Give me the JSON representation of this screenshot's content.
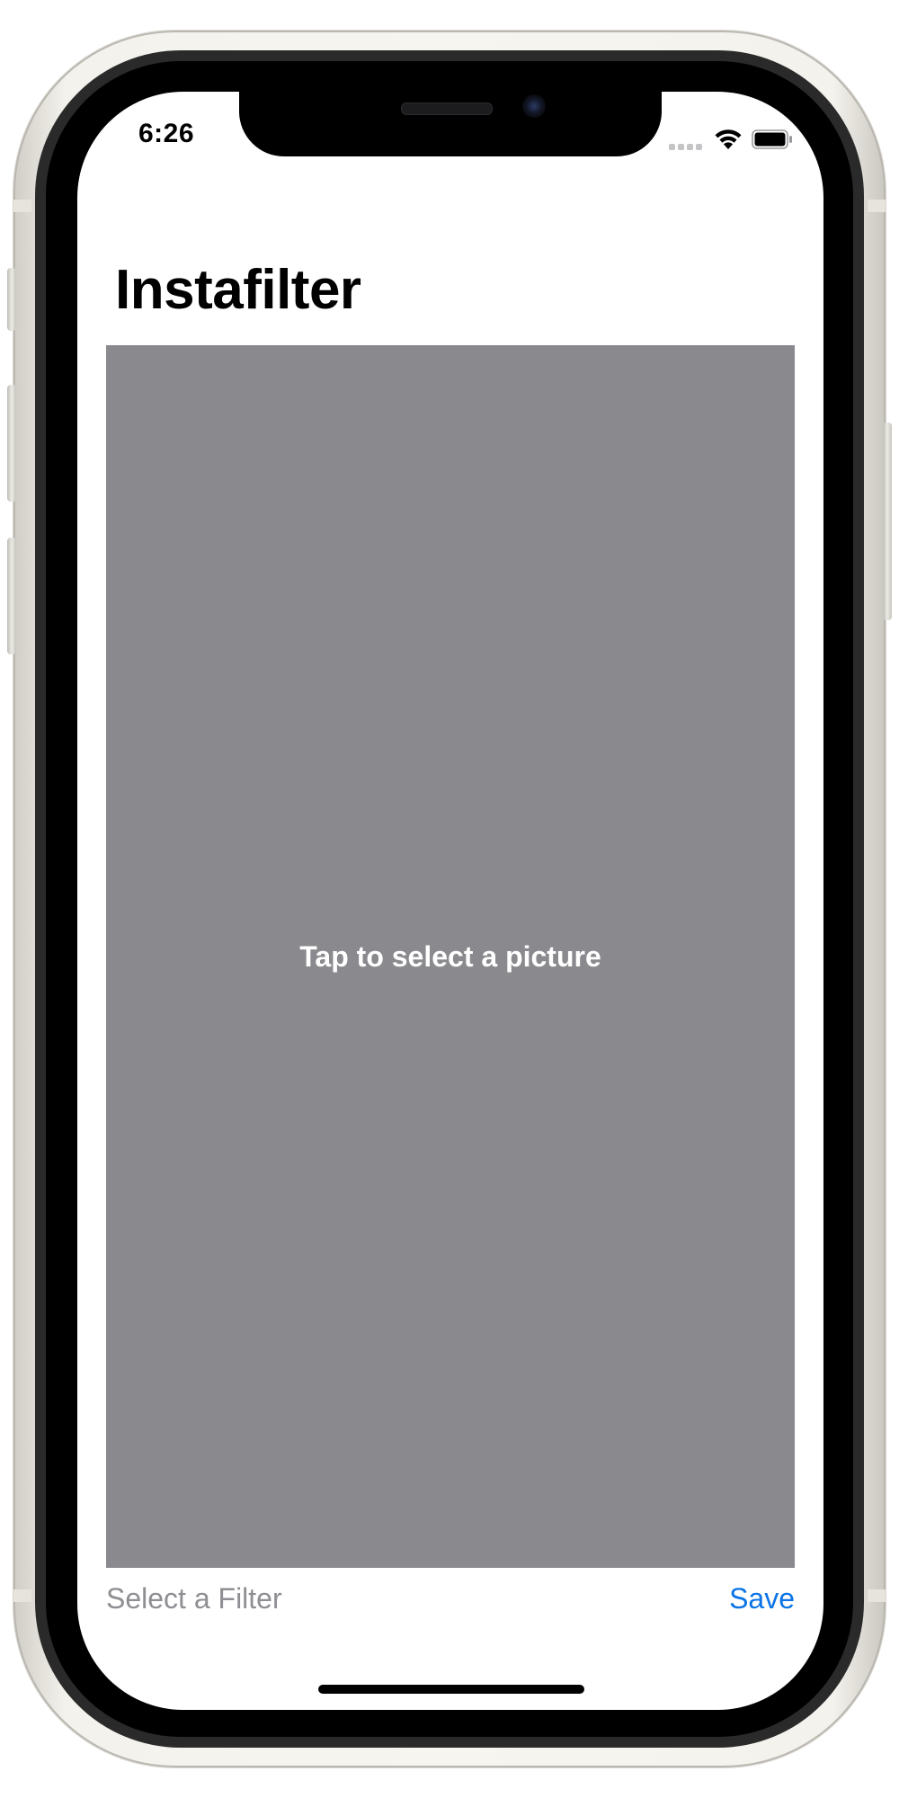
{
  "status_bar": {
    "time": "6:26",
    "icons": [
      "cellular-signal-icon",
      "wifi-icon",
      "battery-icon"
    ],
    "battery_level": 1.0
  },
  "navigation": {
    "title": "Instafilter"
  },
  "picture_area": {
    "prompt": "Tap to select a picture",
    "background_color": "#8a898e"
  },
  "toolbar": {
    "filter_label": "Select a Filter",
    "save_label": "Save"
  },
  "colors": {
    "accent": "#0a74e6",
    "disabled_text": "#8e8e93",
    "placeholder_fill": "#8a898e",
    "device_frame": "#f4f2ec"
  }
}
